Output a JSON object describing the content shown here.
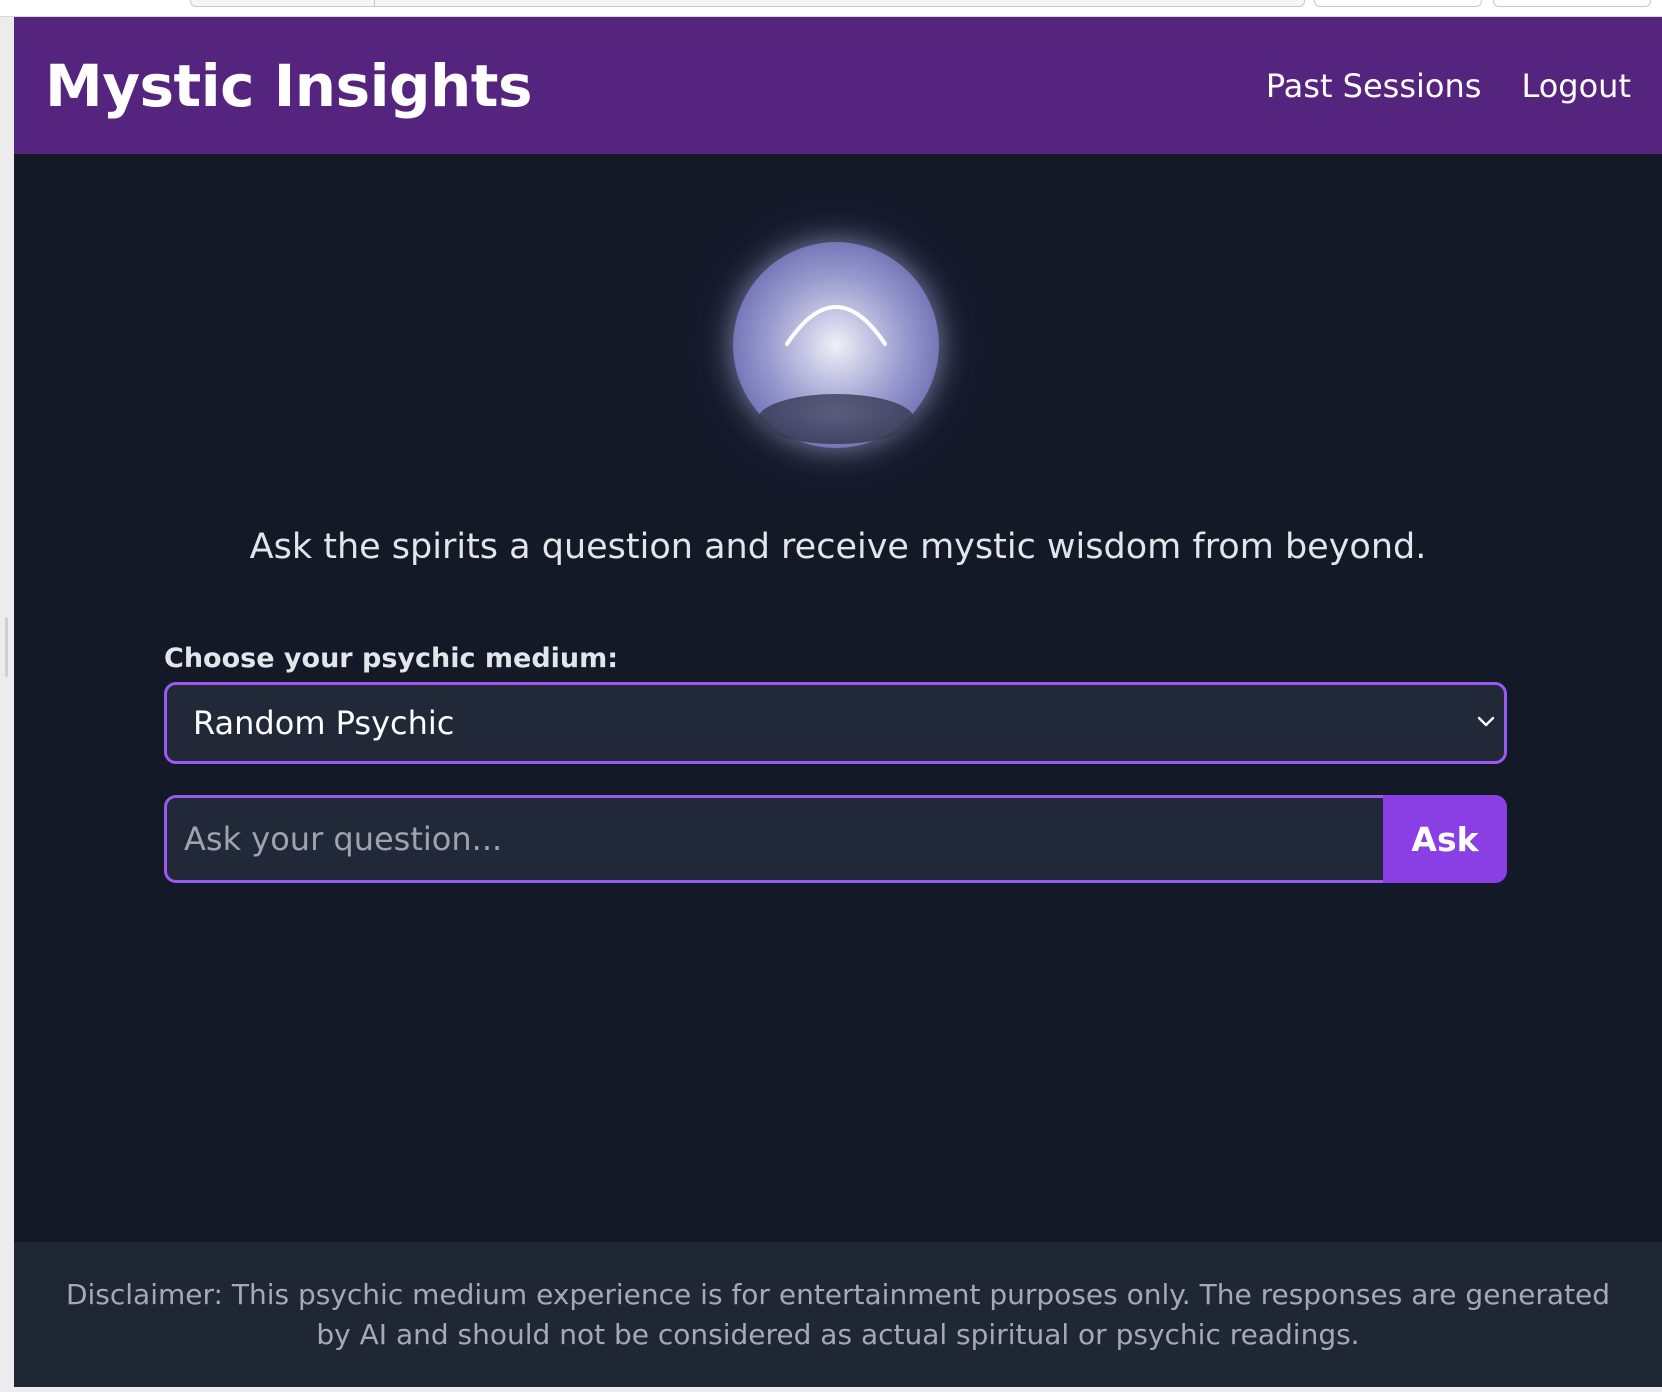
{
  "app": {
    "title": "Mystic Insights",
    "nav": {
      "past_sessions": "Past Sessions",
      "logout": "Logout"
    }
  },
  "main": {
    "tagline": "Ask the spirits a question and receive mystic wisdom from beyond.",
    "medium_label": "Choose your psychic medium:",
    "medium_selected": "Random Psychic",
    "question_placeholder": "Ask your question...",
    "question_value": "",
    "ask_label": "Ask"
  },
  "footer": {
    "disclaimer": "Disclaimer: This psychic medium experience is for entertainment purposes only. The responses are generated by AI and should not be considered as actual spiritual or psychic readings."
  },
  "icons": {
    "orb": "crystal-ball-icon",
    "select_arrow": "chevron-down-icon"
  },
  "colors": {
    "header_bg": "#54247f",
    "page_bg": "#131927",
    "accent": "#8a3fe4",
    "accent_border": "#9b59f1",
    "field_bg": "#212838",
    "footer_bg": "#202734"
  }
}
